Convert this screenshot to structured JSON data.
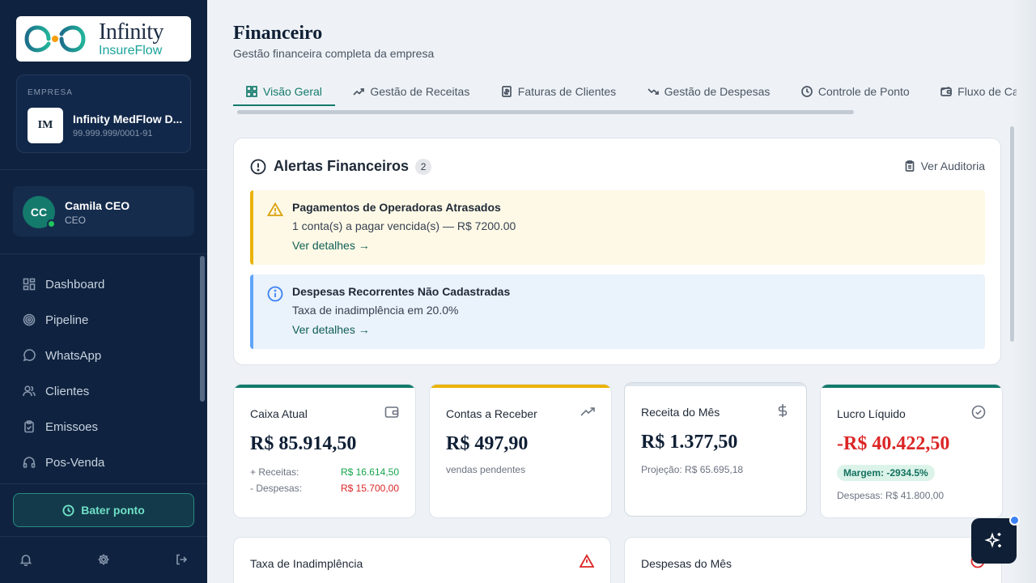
{
  "brand": {
    "name_line1": "Infinity",
    "name_line2": "InsureFlow",
    "primary_color": "#147a6c",
    "sidebar_color": "#0f2340"
  },
  "company": {
    "label": "EMPRESA",
    "initials": "IM",
    "name": "Infinity MedFlow D...",
    "cnpj": "99.999.999/0001-91"
  },
  "user": {
    "initials": "CC",
    "name": "Camila CEO",
    "role": "CEO",
    "online": true
  },
  "nav": {
    "items": [
      {
        "label": "Dashboard",
        "icon": "dashboard-icon"
      },
      {
        "label": "Pipeline",
        "icon": "target-icon"
      },
      {
        "label": "WhatsApp",
        "icon": "chat-icon"
      },
      {
        "label": "Clientes",
        "icon": "users-icon"
      },
      {
        "label": "Emissoes",
        "icon": "clipboard-icon"
      },
      {
        "label": "Pos-Venda",
        "icon": "headphones-icon"
      }
    ]
  },
  "punch_button": {
    "label": "Bater ponto"
  },
  "page": {
    "title": "Financeiro",
    "subtitle": "Gestão financeira completa da empresa"
  },
  "tabs": [
    {
      "label": "Visão Geral",
      "active": true,
      "icon": "grid-icon"
    },
    {
      "label": "Gestão de Receitas",
      "active": false,
      "icon": "trending-up-icon"
    },
    {
      "label": "Faturas de Clientes",
      "active": false,
      "icon": "invoice-icon"
    },
    {
      "label": "Gestão de Despesas",
      "active": false,
      "icon": "trending-down-icon"
    },
    {
      "label": "Controle de Ponto",
      "active": false,
      "icon": "clock-icon"
    },
    {
      "label": "Fluxo de Caixa",
      "active": false,
      "icon": "wallet-icon"
    }
  ],
  "alerts_panel": {
    "title": "Alertas Financeiros",
    "count": "2",
    "audit_link": "Ver Auditoria",
    "alerts": [
      {
        "type": "warning",
        "title": "Pagamentos de Operadoras Atrasados",
        "description": "1 conta(s) a pagar vencida(s) — R$ 7200.00",
        "link": "Ver detalhes →"
      },
      {
        "type": "info",
        "title": "Despesas Recorrentes Não Cadastradas",
        "description": "Taxa de inadimplência em 20.0%",
        "link": "Ver detalhes →"
      }
    ]
  },
  "kpis": {
    "caixa": {
      "title": "Caixa Atual",
      "value": "R$ 85.914,50",
      "receitas_label": "+ Receitas:",
      "receitas_value": "R$ 16.614,50",
      "despesas_label": "- Despesas:",
      "despesas_value": "R$ 15.700,00",
      "accent": "#147a6c"
    },
    "receber": {
      "title": "Contas a Receber",
      "value": "R$ 497,90",
      "note": "vendas pendentes",
      "accent": "#eab308"
    },
    "receita": {
      "title": "Receita do Mês",
      "value": "R$ 1.377,50",
      "note": "Projeção: R$ 65.695,18",
      "accent": "#cfd8e0"
    },
    "lucro": {
      "title": "Lucro Líquido",
      "value": "-R$ 40.422,50",
      "margin": "Margem: -2934.5%",
      "note": "Despesas: R$ 41.800,00",
      "accent": "#147a6c"
    }
  },
  "lower_cards": [
    {
      "title": "Taxa de Inadimplência",
      "icon": "warning-icon"
    },
    {
      "title": "Despesas do Mês",
      "icon": "alert-icon"
    }
  ]
}
